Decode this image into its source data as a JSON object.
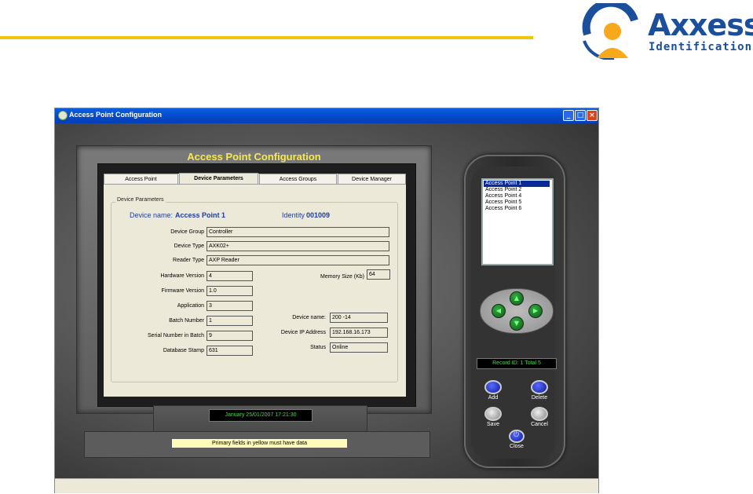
{
  "logo": {
    "word": "Axxess",
    "sub": "Identification"
  },
  "window": {
    "title": "Access Point Configuration",
    "heading": "Access Point Configuration",
    "controls": {
      "minimize": "_",
      "maximize": "□",
      "close": "×"
    }
  },
  "tabs": [
    "Access Point",
    "Device Parameters",
    "Access Groups",
    "Device Manager"
  ],
  "active_tab": "Device Parameters",
  "group_title": "Device Parameters",
  "device_name_label": "Device name:",
  "device_name_value": "Access Point 1",
  "identity_label": "Identity",
  "identity_value": "001009",
  "fields": {
    "device_group": {
      "label": "Device Group",
      "value": "Controller"
    },
    "device_type": {
      "label": "Device Type",
      "value": "AXK02+"
    },
    "reader_type": {
      "label": "Reader Type",
      "value": "AXP Reader"
    },
    "hardware_version": {
      "label": "Hardware Version",
      "value": "4"
    },
    "memory_size": {
      "label": "Memory Size (Kb)",
      "value": "64"
    },
    "firmware_version": {
      "label": "Firmware Version",
      "value": "1.0"
    },
    "application": {
      "label": "Application",
      "value": "3"
    },
    "batch_number": {
      "label": "Batch Number",
      "value": "1"
    },
    "device_name2": {
      "label": "Device name:",
      "value": "200 -14"
    },
    "serial_number": {
      "label": "Serial Number in Batch",
      "value": "9"
    },
    "device_ip": {
      "label": "Device IP Address",
      "value": "192.168.16.173"
    },
    "database_stamp": {
      "label": "Database Stamp",
      "value": "631"
    },
    "status": {
      "label": "Status",
      "value": "Online"
    }
  },
  "access_points": [
    "Access Point 1",
    "Access Point 2",
    "Access Point 4",
    "Access Point 5",
    "Access Point 6"
  ],
  "selected_access_point": "Access Point 1",
  "record_status": "Record ID: 1 Total 5",
  "buttons": {
    "add": "Add",
    "delete": "Delete",
    "save": "Save",
    "cancel": "Cancel",
    "close": "Close"
  },
  "date_display": "January  25/01/2007 17:21:30",
  "message": "Primary fields in yellow must have data",
  "colors": {
    "heading": "#f6e94a",
    "accent_blue": "#1e3ea0",
    "led_green": "#4ad64a",
    "message_bg": "#fffbb8"
  }
}
